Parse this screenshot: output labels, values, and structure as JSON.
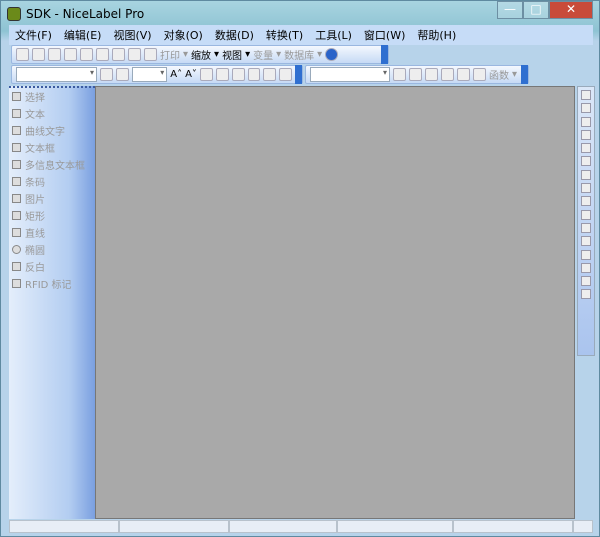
{
  "window": {
    "title": "SDK - NiceLabel Pro",
    "controls": [
      "minimize",
      "maximize",
      "close"
    ]
  },
  "menu": [
    "文件(F)",
    "编辑(E)",
    "视图(V)",
    "对象(O)",
    "数据(D)",
    "转换(T)",
    "工具(L)",
    "窗口(W)",
    "帮助(H)"
  ],
  "toolbar1": {
    "print": "打印",
    "zoom": "缩放",
    "view": "视图",
    "variable": "变量",
    "database": "数据库"
  },
  "toolbar2": {
    "font_value": "",
    "size_value": "",
    "var_value": "",
    "function": "函数"
  },
  "tools": [
    "选择",
    "文本",
    "曲线文字",
    "文本框",
    "多信息文本框",
    "条码",
    "图片",
    "矩形",
    "直线",
    "椭圆",
    "反白",
    "RFID 标记"
  ]
}
